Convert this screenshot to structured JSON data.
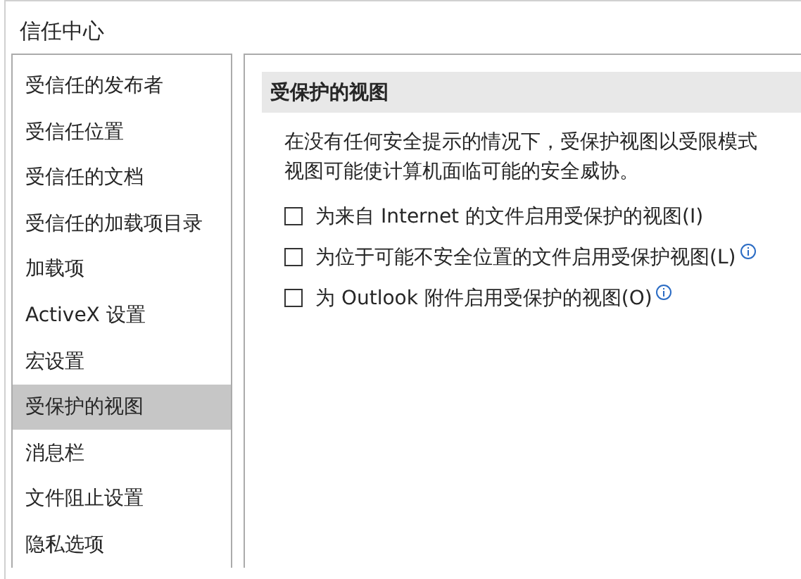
{
  "window": {
    "title": "信任中心"
  },
  "sidebar": {
    "items": [
      {
        "label": "受信任的发布者",
        "selected": false
      },
      {
        "label": "受信任位置",
        "selected": false
      },
      {
        "label": "受信任的文档",
        "selected": false
      },
      {
        "label": "受信任的加载项目录",
        "selected": false
      },
      {
        "label": "加载项",
        "selected": false
      },
      {
        "label": "ActiveX 设置",
        "selected": false
      },
      {
        "label": "宏设置",
        "selected": false
      },
      {
        "label": "受保护的视图",
        "selected": true
      },
      {
        "label": "消息栏",
        "selected": false
      },
      {
        "label": "文件阻止设置",
        "selected": false
      },
      {
        "label": "隐私选项",
        "selected": false
      }
    ]
  },
  "section": {
    "title": "受保护的视图",
    "description": [
      "在没有任何安全提示的情况下，受保护视图以受限模式",
      "视图可能使计算机面临可能的安全威协。"
    ],
    "options": [
      {
        "label": "为来自 Internet 的文件启用受保护的视图(I)",
        "checked": false,
        "info": false
      },
      {
        "label": "为位于可能不安全位置的文件启用受保护视图(L)",
        "checked": false,
        "info": true
      },
      {
        "label": "为 Outlook 附件启用受保护的视图(O)",
        "checked": false,
        "info": true
      }
    ]
  }
}
